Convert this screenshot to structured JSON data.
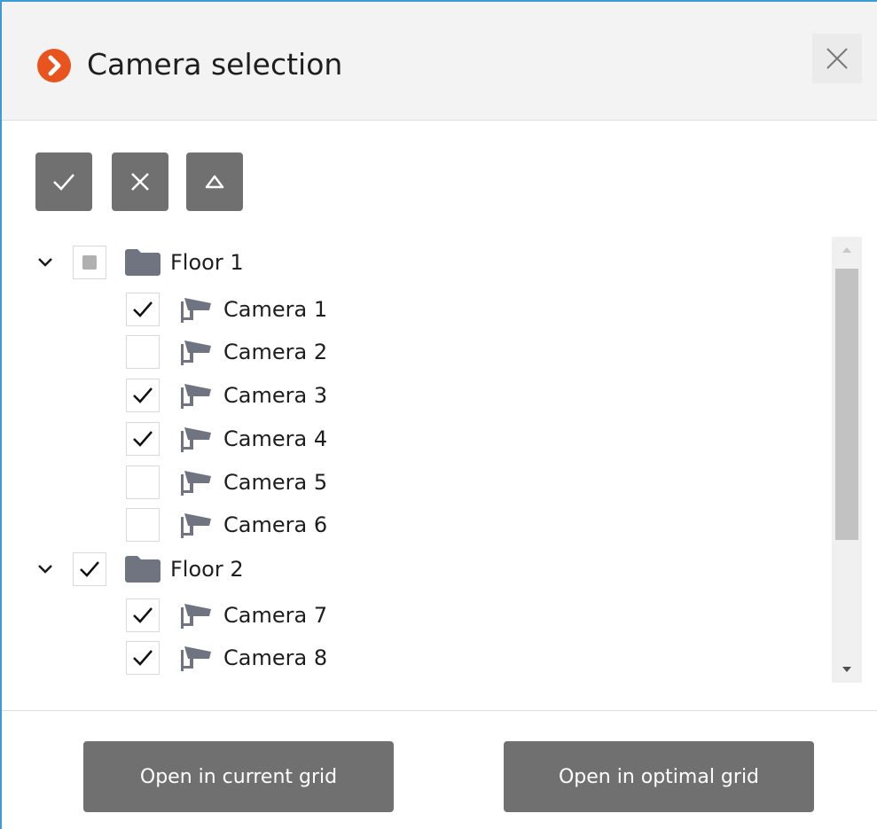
{
  "dialog": {
    "title": "Camera selection",
    "accent_color": "#e8531e",
    "icon": "chevron-right-circle-icon",
    "close_icon": "close-icon"
  },
  "toolbar": {
    "buttons": [
      {
        "name": "select-all-button",
        "icon": "check-icon"
      },
      {
        "name": "deselect-all-button",
        "icon": "x-icon"
      },
      {
        "name": "collapse-all-button",
        "icon": "triangle-up-icon"
      }
    ]
  },
  "tree": {
    "groups": [
      {
        "label": "Floor 1",
        "expanded": true,
        "state": "partial",
        "cameras": [
          {
            "label": "Camera 1",
            "checked": true
          },
          {
            "label": "Camera 2",
            "checked": false
          },
          {
            "label": "Camera 3",
            "checked": true
          },
          {
            "label": "Camera 4",
            "checked": true
          },
          {
            "label": "Camera 5",
            "checked": false
          },
          {
            "label": "Camera 6",
            "checked": false
          }
        ]
      },
      {
        "label": "Floor 2",
        "expanded": true,
        "state": "checked",
        "cameras": [
          {
            "label": "Camera 7",
            "checked": true
          },
          {
            "label": "Camera 8",
            "checked": true
          }
        ]
      }
    ]
  },
  "footer": {
    "open_current": "Open in current grid",
    "open_optimal": "Open in optimal grid"
  }
}
